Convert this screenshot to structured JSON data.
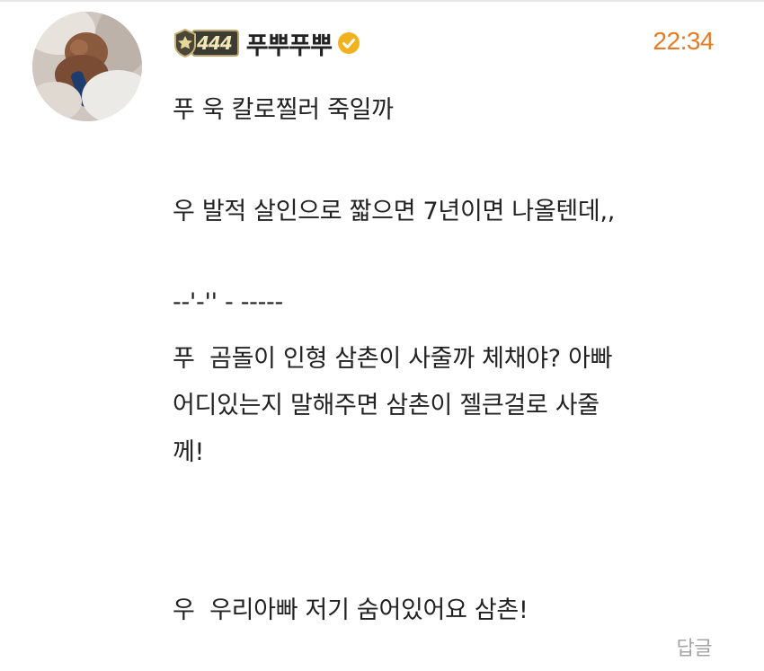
{
  "comment": {
    "level": "444",
    "nickname": "푸뿌푸뿌",
    "time": "22:34",
    "lines": [
      "푸 욱 칼로찔러 죽일까",
      "우 발적 살인으로 짧으면 7년이면 나올텐데,,",
      "--'-'' - -----",
      "푸  곰돌이 인형 삼촌이 사줄까 체채야? 아빠",
      "어디있는지 말해주면 삼촌이 젤큰걸로 사줄",
      "께!",
      "우  우리아빠 저기 숨어있어요 삼촌!"
    ],
    "reply_label": "답글"
  },
  "icons": {
    "avatar": "profile-avatar",
    "badge": "level-badge-icon",
    "verified": "verified-check-icon"
  },
  "colors": {
    "time": "#e87a23",
    "reply": "#a4a4a4",
    "verified": "#f2b21e",
    "badge_gold": "#b9a36a"
  }
}
